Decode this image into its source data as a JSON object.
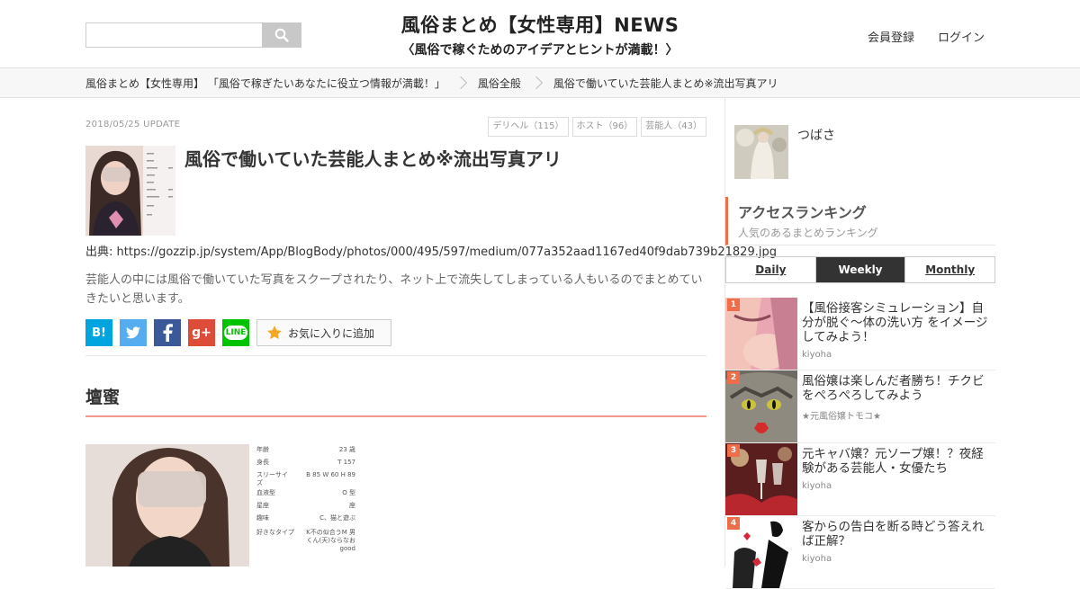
{
  "header": {
    "search": {
      "placeholder": ""
    },
    "logo_line1": "風俗まとめ【女性専用】NEWS",
    "logo_line2": "〈風俗で稼ぐためのアイデアとヒントが満載！〉",
    "register": "会員登録",
    "login": "ログイン"
  },
  "breadcrumb": [
    "風俗まとめ【女性専用】 「風俗で稼ぎたいあなたに役立つ情報が満載！」",
    "風俗全般",
    "風俗で働いていた芸能人まとめ※流出写真アリ"
  ],
  "article": {
    "date": "2018/05/25 UPDATE",
    "tags": [
      "デリヘル（115）",
      "ホスト（96）",
      "芸能人（43）"
    ],
    "title": "風俗で働いていた芸能人まとめ※流出写真アリ",
    "source": "出典: https://gozzip.jp/system/App/BlogBody/photos/000/495/597/medium/077a352aad1167ed40f9dab739b21829.jpg",
    "description": "芸能人の中には風俗で働いていた写真をスクープされたり、ネット上で流失してしまっている人もいるのでまとめていきたいと思います。",
    "share": {
      "hatena": "B!",
      "gplus": "g+",
      "line": "LINE",
      "favorite": "お気に入りに追加"
    },
    "section_title": "壇蜜",
    "profile": [
      [
        "年齢",
        "23 歳"
      ],
      [
        "身長",
        "T 157"
      ],
      [
        "スリーサイズ",
        "B 85 W 60 H 89"
      ],
      [
        "血液型",
        "O 型"
      ],
      [
        "星座",
        "座"
      ],
      [
        "趣味",
        "C、猫と遊ぶ"
      ],
      [
        "好きなタイプ",
        "K不の似合うM 男くん(天)ならなおgood"
      ]
    ]
  },
  "sidebar": {
    "user_name": "つばさ",
    "ranking_title": "アクセスランキング",
    "ranking_subtitle": "人気のあるまとめランキング",
    "tabs": [
      "Daily",
      "Weekly",
      "Monthly"
    ],
    "active_tab": "Weekly",
    "ranking": [
      {
        "rank": "1",
        "title": "【風俗接客シミュレーション】自分が脱ぐ～体の洗い方 をイメージしてみよう！",
        "author": "kiyoha"
      },
      {
        "rank": "2",
        "title": "風俗嬢は楽しんだ者勝ち！チクビをぺろぺろしてみよう",
        "author": "★元風俗嬢トモコ★"
      },
      {
        "rank": "3",
        "title": "元キャバ嬢？元ソープ嬢！？夜経験がある芸能人・女優たち",
        "author": "kiyoha"
      },
      {
        "rank": "4",
        "title": "客からの告白を断る時どう答えれば正解？",
        "author": "kiyoha"
      }
    ]
  },
  "colors": {
    "accent": "#ee6e4c",
    "rule": "#f29a8e",
    "hatena": "#00a4de",
    "twitter": "#55acee",
    "facebook": "#3b5998",
    "gplus": "#dd4b39",
    "line": "#00c300"
  }
}
